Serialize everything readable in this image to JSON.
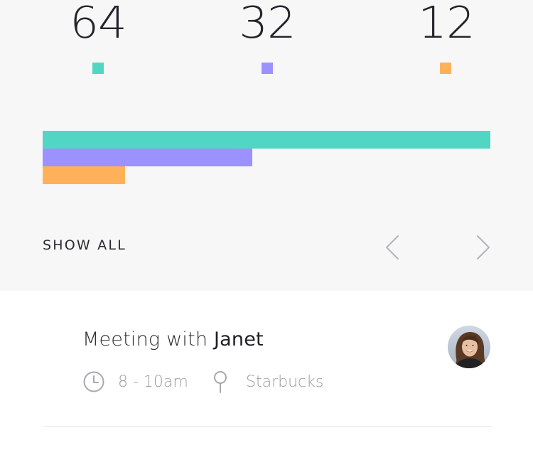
{
  "stats": [
    {
      "value": "64",
      "color": "#52d6c4",
      "fraction": 1.0
    },
    {
      "value": "32",
      "color": "#9b92ff",
      "fraction": 0.468
    },
    {
      "value": "12",
      "color": "#ffb159",
      "fraction": 0.184
    }
  ],
  "controls": {
    "show_all_label": "SHOW ALL",
    "prev_icon": "chevron-left-icon",
    "next_icon": "chevron-right-icon"
  },
  "event": {
    "title_prefix": "Meeting with",
    "title_name": "Janet",
    "time": "8 - 10am",
    "location": "Starbucks",
    "time_icon": "clock-icon",
    "location_icon": "location-pin-icon",
    "avatar_icon": "avatar"
  }
}
